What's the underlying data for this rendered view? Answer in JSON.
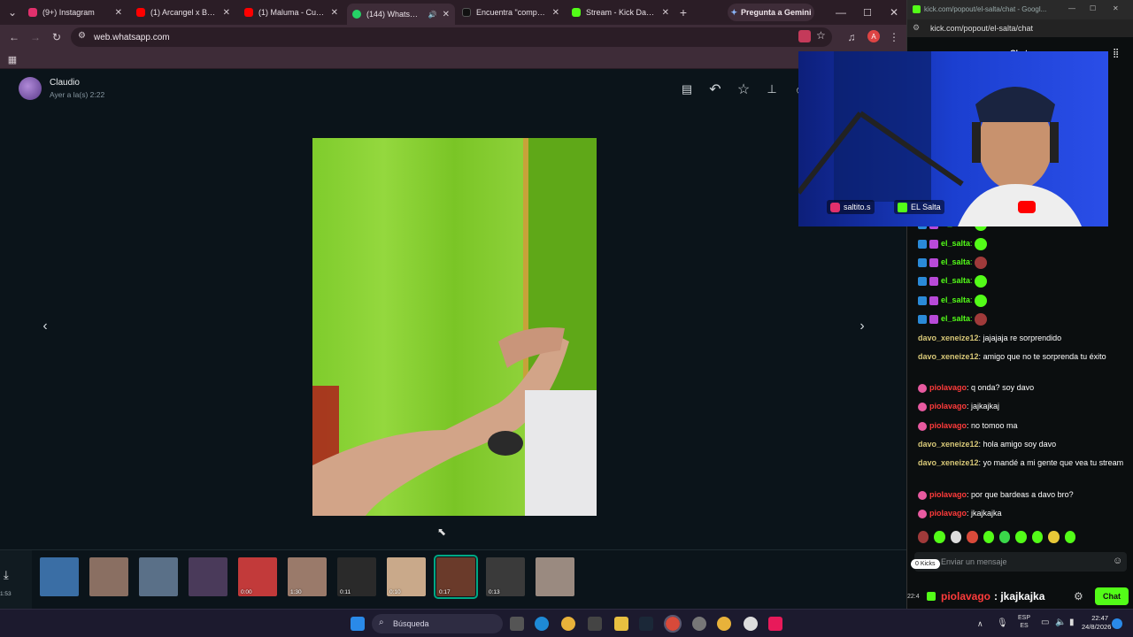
{
  "browser": {
    "tabs": [
      {
        "title": "(9+) Instagram",
        "color": "#e1306c"
      },
      {
        "title": "(1) Arcangel x Bad Bunny",
        "color": "#ff0000"
      },
      {
        "title": "(1) Maluma - Cuatro",
        "color": "#ff0000"
      },
      {
        "title": "(144) WhatsApp",
        "color": "#25d366"
      },
      {
        "title": "Encuentra \"compe de",
        "color": "#000000"
      },
      {
        "title": "Stream - Kick Dashb",
        "color": "#53fc18"
      }
    ],
    "gemini_button": "Pregunta a Gemini",
    "url": "web.whatsapp.com",
    "profile_letter": "A"
  },
  "viewer": {
    "sender": "Claudio",
    "timestamp": "Ayer a la(s) 2:22",
    "left_counter": "1:53",
    "thumbnails": [
      {
        "duration": "",
        "color": "#3a6ea5"
      },
      {
        "duration": "",
        "color": "#8a6f62"
      },
      {
        "duration": "",
        "color": "#5a7088"
      },
      {
        "duration": "",
        "color": "#4a3a5a"
      },
      {
        "duration": "0:00",
        "color": "#c23a3a"
      },
      {
        "duration": "1:30",
        "color": "#9a7a6a"
      },
      {
        "duration": "0:11",
        "color": "#2a2a2a"
      },
      {
        "duration": "0:10",
        "color": "#c9a98a"
      },
      {
        "duration": "0:17",
        "color": "#6a3a2a",
        "selected": true
      },
      {
        "duration": "0:13",
        "color": "#3a3a3a"
      },
      {
        "duration": "",
        "color": "#9a8a80"
      }
    ]
  },
  "kick": {
    "window_title": "kick.com/popout/el-salta/chat - Googl...",
    "url": "kick.com/popout/el-salta/chat",
    "tab_label": "Chat",
    "webcam_overlay": {
      "instagram": "saltito.s",
      "kick": "EL Salta"
    },
    "messages": [
      {
        "user": "el_salta",
        "text": "",
        "color": "#53fc18",
        "emote": true
      },
      {
        "user": "el_salta",
        "text": "",
        "color": "#53fc18",
        "emote": true
      },
      {
        "user": "el_salta",
        "text": "",
        "color": "#53fc18",
        "emote": true
      },
      {
        "user": "el_salta",
        "text": "",
        "color": "#53fc18",
        "emote": true
      },
      {
        "user": "el_salta",
        "text": "",
        "color": "#53fc18",
        "emote": true
      },
      {
        "user": "davo_xeneize12",
        "text": "jajajaja re sorprendido",
        "color": "#d8c878"
      },
      {
        "user": "davo_xeneize12",
        "text": "amigo que no te sorprenda tu éxito",
        "color": "#d8c878"
      },
      {
        "user": "piolavago",
        "text": "q onda? soy davo",
        "color": "#ff3b3b"
      },
      {
        "user": "piolavago",
        "text": "jajkajkaj",
        "color": "#ff3b3b"
      },
      {
        "user": "piolavago",
        "text": "no tomoo ma",
        "color": "#ff3b3b"
      },
      {
        "user": "davo_xeneize12",
        "text": "hola amigo soy davo",
        "color": "#d8c878"
      },
      {
        "user": "davo_xeneize12",
        "text": "yo mandé a mi gente que vea tu stream",
        "color": "#d8c878"
      },
      {
        "user": "piolavago",
        "text": "por que bardeas a davo bro?",
        "color": "#ff3b3b"
      },
      {
        "user": "piolavago",
        "text": "jkajkajka",
        "color": "#ff3b3b"
      }
    ],
    "kicks_badge": "0 Kicks",
    "input_placeholder": "Enviar un mensaje",
    "time_left": "22:4",
    "pinned_user": "piolavago",
    "pinned_text": ": jkajkajka",
    "send_label": "Chat"
  },
  "taskbar": {
    "search": "Búsqueda",
    "lang": "ESP",
    "lang2": "ES",
    "time": "22:47",
    "date": "24/8/2026"
  }
}
